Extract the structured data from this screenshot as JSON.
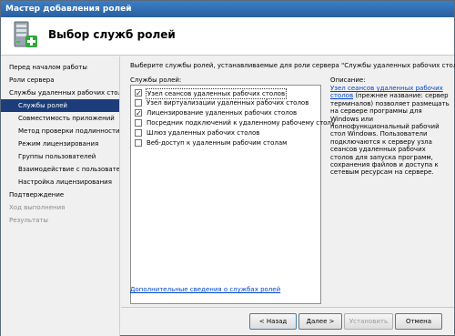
{
  "window": {
    "title": "Мастер добавления ролей"
  },
  "header": {
    "title": "Выбор служб ролей",
    "icon": "server-add-icon"
  },
  "sidebar": {
    "items": [
      {
        "label": "Перед началом работы",
        "level": 0,
        "state": "normal"
      },
      {
        "label": "Роли сервера",
        "level": 0,
        "state": "normal"
      },
      {
        "label": "Службы удаленных рабочих столов",
        "level": 0,
        "state": "normal"
      },
      {
        "label": "Службы ролей",
        "level": 1,
        "state": "selected"
      },
      {
        "label": "Совместимость приложений",
        "level": 1,
        "state": "normal"
      },
      {
        "label": "Метод проверки подлинности",
        "level": 1,
        "state": "normal"
      },
      {
        "label": "Режим лицензирования",
        "level": 1,
        "state": "normal"
      },
      {
        "label": "Группы пользователей",
        "level": 1,
        "state": "normal"
      },
      {
        "label": "Взаимодействие с пользователем",
        "level": 1,
        "state": "normal"
      },
      {
        "label": "Настройка лицензирования",
        "level": 1,
        "state": "normal"
      },
      {
        "label": "Подтверждение",
        "level": 0,
        "state": "normal"
      },
      {
        "label": "Ход выполнения",
        "level": 0,
        "state": "disabled"
      },
      {
        "label": "Результаты",
        "level": 0,
        "state": "disabled"
      }
    ]
  },
  "main": {
    "instruction": "Выберите службы ролей, устанавливаемые для роли сервера \"Службы удаленных рабочих столов\":",
    "roles_label": "Службы ролей:",
    "roles": [
      {
        "label": "Узел сеансов удаленных рабочих столов",
        "checked": true,
        "focused": true
      },
      {
        "label": "Узел виртуализации удаленных рабочих столов",
        "checked": false,
        "focused": false
      },
      {
        "label": "Лицензирование удаленных рабочих столов",
        "checked": true,
        "focused": false
      },
      {
        "label": "Посредник подключений к удаленному рабочему столу",
        "checked": false,
        "focused": false
      },
      {
        "label": "Шлюз удаленных рабочих столов",
        "checked": false,
        "focused": false
      },
      {
        "label": "Веб-доступ к удаленным рабочим столам",
        "checked": false,
        "focused": false
      }
    ],
    "description_label": "Описание:",
    "description_link": "Узел сеансов удаленных рабочих столов",
    "description_text": " (прежнее название: сервер терминалов) позволяет размещать на сервере программы для Windows или полнофункциональный рабочий стол Windows. Пользователи подключаются к серверу узла сеансов удаленных рабочих столов для запуска программ, сохранения файлов и доступа к сетевым ресурсам на сервере.",
    "more_link": "Дополнительные сведения о службах ролей"
  },
  "buttons": {
    "prev": "< Назад",
    "next": "Далее >",
    "install": "Установить",
    "cancel": "Отмена"
  },
  "colors": {
    "titlebar": "#2a5f9f",
    "selected": "#1c3d7a",
    "link": "#0044cc"
  }
}
